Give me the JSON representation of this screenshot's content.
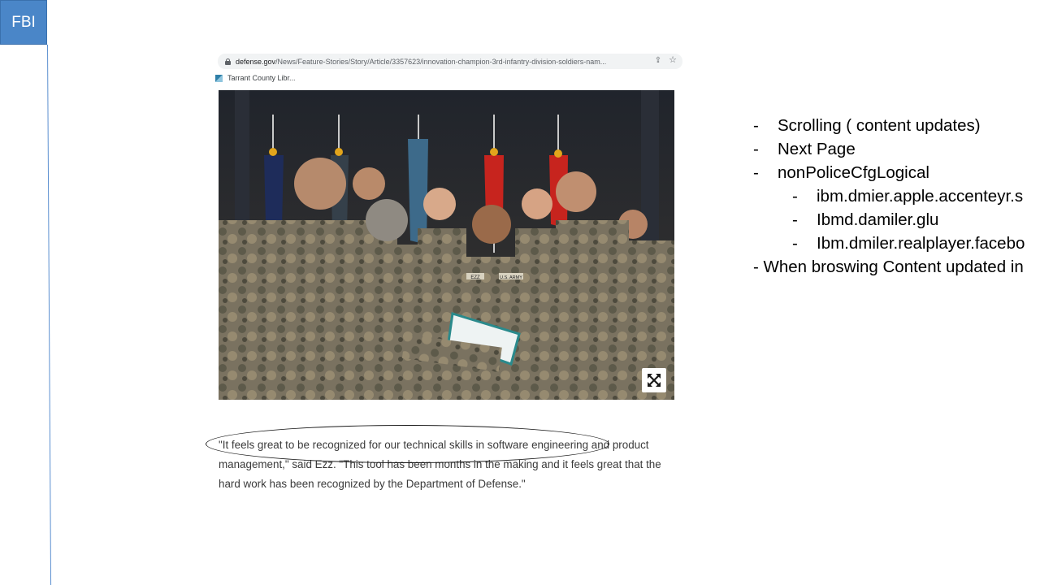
{
  "badge": {
    "label": "FBI",
    "color": "#4a86c8"
  },
  "browser": {
    "url_domain": "defense.gov",
    "url_path": "/News/Feature-Stories/Story/Article/3357623/innovation-champion-3rd-infantry-division-soldiers-nam...",
    "bookmark_label": "Tarrant County Libr..."
  },
  "icons": {
    "lock": "lock-icon",
    "share": "share-icon",
    "star": "star-icon",
    "expand": "expand-icon",
    "bookmark": "bookmark-favicon"
  },
  "photo": {
    "description_icon": "photo-of-soldiers-ceremony",
    "name_tag": "EZZ",
    "uniform_text": "U.S. ARMY"
  },
  "caption": {
    "line1": "\"It feels great to be recognized for our technical skills in software engineering and product",
    "line2": "management,\" said Ezz. \"This tool has been months in the making and it feels great that the",
    "line3": "hard work has been recognized by the Department of Defense.\""
  },
  "notes": {
    "dash": "-",
    "item1": "Scrolling ( content updates)",
    "item2": "Next Page",
    "item3": "nonPoliceCfgLogical",
    "sub1": "ibm.dmier.apple.accenteyr.s",
    "sub2": "Ibmd.damiler.glu",
    "sub3": "Ibm.dmiler.realplayer.facebo",
    "item4": "- When broswing Content updated in"
  }
}
